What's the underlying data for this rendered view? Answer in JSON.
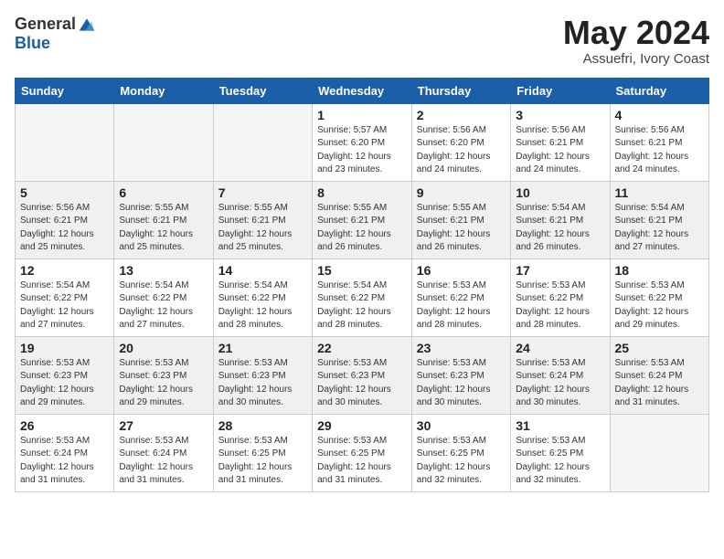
{
  "header": {
    "logo_general": "General",
    "logo_blue": "Blue",
    "month_title": "May 2024",
    "location": "Assuefri, Ivory Coast"
  },
  "weekdays": [
    "Sunday",
    "Monday",
    "Tuesday",
    "Wednesday",
    "Thursday",
    "Friday",
    "Saturday"
  ],
  "weeks": [
    [
      {
        "day": "",
        "info": ""
      },
      {
        "day": "",
        "info": ""
      },
      {
        "day": "",
        "info": ""
      },
      {
        "day": "1",
        "info": "Sunrise: 5:57 AM\nSunset: 6:20 PM\nDaylight: 12 hours\nand 23 minutes."
      },
      {
        "day": "2",
        "info": "Sunrise: 5:56 AM\nSunset: 6:20 PM\nDaylight: 12 hours\nand 24 minutes."
      },
      {
        "day": "3",
        "info": "Sunrise: 5:56 AM\nSunset: 6:21 PM\nDaylight: 12 hours\nand 24 minutes."
      },
      {
        "day": "4",
        "info": "Sunrise: 5:56 AM\nSunset: 6:21 PM\nDaylight: 12 hours\nand 24 minutes."
      }
    ],
    [
      {
        "day": "5",
        "info": "Sunrise: 5:56 AM\nSunset: 6:21 PM\nDaylight: 12 hours\nand 25 minutes."
      },
      {
        "day": "6",
        "info": "Sunrise: 5:55 AM\nSunset: 6:21 PM\nDaylight: 12 hours\nand 25 minutes."
      },
      {
        "day": "7",
        "info": "Sunrise: 5:55 AM\nSunset: 6:21 PM\nDaylight: 12 hours\nand 25 minutes."
      },
      {
        "day": "8",
        "info": "Sunrise: 5:55 AM\nSunset: 6:21 PM\nDaylight: 12 hours\nand 26 minutes."
      },
      {
        "day": "9",
        "info": "Sunrise: 5:55 AM\nSunset: 6:21 PM\nDaylight: 12 hours\nand 26 minutes."
      },
      {
        "day": "10",
        "info": "Sunrise: 5:54 AM\nSunset: 6:21 PM\nDaylight: 12 hours\nand 26 minutes."
      },
      {
        "day": "11",
        "info": "Sunrise: 5:54 AM\nSunset: 6:21 PM\nDaylight: 12 hours\nand 27 minutes."
      }
    ],
    [
      {
        "day": "12",
        "info": "Sunrise: 5:54 AM\nSunset: 6:22 PM\nDaylight: 12 hours\nand 27 minutes."
      },
      {
        "day": "13",
        "info": "Sunrise: 5:54 AM\nSunset: 6:22 PM\nDaylight: 12 hours\nand 27 minutes."
      },
      {
        "day": "14",
        "info": "Sunrise: 5:54 AM\nSunset: 6:22 PM\nDaylight: 12 hours\nand 28 minutes."
      },
      {
        "day": "15",
        "info": "Sunrise: 5:54 AM\nSunset: 6:22 PM\nDaylight: 12 hours\nand 28 minutes."
      },
      {
        "day": "16",
        "info": "Sunrise: 5:53 AM\nSunset: 6:22 PM\nDaylight: 12 hours\nand 28 minutes."
      },
      {
        "day": "17",
        "info": "Sunrise: 5:53 AM\nSunset: 6:22 PM\nDaylight: 12 hours\nand 28 minutes."
      },
      {
        "day": "18",
        "info": "Sunrise: 5:53 AM\nSunset: 6:22 PM\nDaylight: 12 hours\nand 29 minutes."
      }
    ],
    [
      {
        "day": "19",
        "info": "Sunrise: 5:53 AM\nSunset: 6:23 PM\nDaylight: 12 hours\nand 29 minutes."
      },
      {
        "day": "20",
        "info": "Sunrise: 5:53 AM\nSunset: 6:23 PM\nDaylight: 12 hours\nand 29 minutes."
      },
      {
        "day": "21",
        "info": "Sunrise: 5:53 AM\nSunset: 6:23 PM\nDaylight: 12 hours\nand 30 minutes."
      },
      {
        "day": "22",
        "info": "Sunrise: 5:53 AM\nSunset: 6:23 PM\nDaylight: 12 hours\nand 30 minutes."
      },
      {
        "day": "23",
        "info": "Sunrise: 5:53 AM\nSunset: 6:23 PM\nDaylight: 12 hours\nand 30 minutes."
      },
      {
        "day": "24",
        "info": "Sunrise: 5:53 AM\nSunset: 6:24 PM\nDaylight: 12 hours\nand 30 minutes."
      },
      {
        "day": "25",
        "info": "Sunrise: 5:53 AM\nSunset: 6:24 PM\nDaylight: 12 hours\nand 31 minutes."
      }
    ],
    [
      {
        "day": "26",
        "info": "Sunrise: 5:53 AM\nSunset: 6:24 PM\nDaylight: 12 hours\nand 31 minutes."
      },
      {
        "day": "27",
        "info": "Sunrise: 5:53 AM\nSunset: 6:24 PM\nDaylight: 12 hours\nand 31 minutes."
      },
      {
        "day": "28",
        "info": "Sunrise: 5:53 AM\nSunset: 6:25 PM\nDaylight: 12 hours\nand 31 minutes."
      },
      {
        "day": "29",
        "info": "Sunrise: 5:53 AM\nSunset: 6:25 PM\nDaylight: 12 hours\nand 31 minutes."
      },
      {
        "day": "30",
        "info": "Sunrise: 5:53 AM\nSunset: 6:25 PM\nDaylight: 12 hours\nand 32 minutes."
      },
      {
        "day": "31",
        "info": "Sunrise: 5:53 AM\nSunset: 6:25 PM\nDaylight: 12 hours\nand 32 minutes."
      },
      {
        "day": "",
        "info": ""
      }
    ]
  ]
}
